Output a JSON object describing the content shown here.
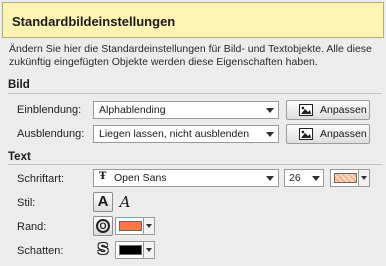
{
  "header": {
    "title": "Standardbildeinstellungen"
  },
  "description": "Ändern Sie hier die Standardeinstellungen für Bild- und Textobjekte. Alle diese zukünftig eingefügten Objekte werden diese Eigenschaften haben.",
  "bild": {
    "title": "Bild",
    "einblendung": {
      "label": "Einblendung:",
      "value": "Alphablending",
      "button": "Anpassen"
    },
    "ausblendung": {
      "label": "Ausblendung:",
      "value": "Liegen lassen, nicht ausblenden",
      "button": "Anpassen"
    }
  },
  "text": {
    "title": "Text",
    "schriftart": {
      "label": "Schriftart:",
      "font_icon": "Ŧ",
      "value": "Open Sans",
      "size": "26",
      "fill_color": "#f4b48a"
    },
    "stil": {
      "label": "Stil:",
      "bold_glyph": "A",
      "italic_glyph": "A"
    },
    "rand": {
      "label": "Rand:",
      "outline_glyph": "O",
      "color": "#ff7a45"
    },
    "schatten": {
      "label": "Schatten:",
      "shadow_glyph": "S",
      "color": "#000000"
    }
  }
}
